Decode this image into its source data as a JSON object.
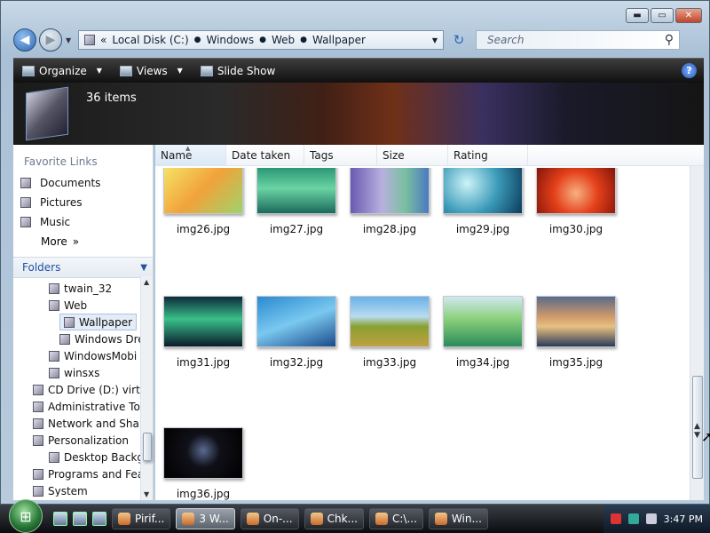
{
  "window": {
    "controls": {
      "minimize": "▬",
      "maximize": "▭",
      "close": "✕"
    }
  },
  "address": {
    "back_icon": "back-arrow-icon",
    "forward_icon": "forward-arrow-icon",
    "lead": "«",
    "crumbs": [
      "Local Disk (C:)",
      "Windows",
      "Web",
      "Wallpaper"
    ],
    "search_placeholder": "Search"
  },
  "toolbar": {
    "organize": "Organize",
    "views": "Views",
    "slideshow": "Slide Show",
    "help": "?"
  },
  "header": {
    "item_count": "36 items"
  },
  "sidebar": {
    "favorite_links_heading": "Favorite Links",
    "links": [
      "Documents",
      "Pictures",
      "Music"
    ],
    "more": "More",
    "folders_heading": "Folders",
    "tree": [
      {
        "label": "twain_32",
        "indent": 1
      },
      {
        "label": "Web",
        "indent": 1
      },
      {
        "label": "Wallpaper",
        "indent": 2,
        "selected": true
      },
      {
        "label": "Windows Dre",
        "indent": 2
      },
      {
        "label": "WindowsMobi",
        "indent": 1
      },
      {
        "label": "winsxs",
        "indent": 1
      },
      {
        "label": "CD Drive (D:) virtio",
        "indent": 0
      },
      {
        "label": "Administrative Too",
        "indent": 0
      },
      {
        "label": "Network and Shari",
        "indent": 0
      },
      {
        "label": "Personalization",
        "indent": 0
      },
      {
        "label": "Desktop Backgro",
        "indent": 1
      },
      {
        "label": "Programs and Feat",
        "indent": 0
      },
      {
        "label": "System",
        "indent": 0
      }
    ]
  },
  "columns": [
    "Name",
    "Date taken",
    "Tags",
    "Size",
    "Rating"
  ],
  "files": [
    {
      "name": "img26.jpg",
      "bg": "linear-gradient(135deg,#f5e66a,#f2a23a 50%,#9fd36a)"
    },
    {
      "name": "img27.jpg",
      "bg": "linear-gradient(180deg,#1f8a6a,#6ad4a4 50%,#1a6a5a)"
    },
    {
      "name": "img28.jpg",
      "bg": "linear-gradient(90deg,#6a5ab0,#b8b0e0 40%,#7ac0a0 70%,#4a7ac0)"
    },
    {
      "name": "img29.jpg",
      "bg": "radial-gradient(circle at 30% 40%,#cdf3f8,#3a9ab8 50%,#0d3a5a)"
    },
    {
      "name": "img30.jpg",
      "bg": "radial-gradient(circle at 50% 60%,#f7b080,#e4401a 45%,#7a1008)"
    },
    {
      "name": "img31.jpg",
      "bg": "linear-gradient(180deg,#0c2a3a,#3ac08a 45%,#0a1a2a)"
    },
    {
      "name": "img32.jpg",
      "bg": "linear-gradient(160deg,#2a8ad0,#7ac8f0 50%,#1a4a8a)"
    },
    {
      "name": "img33.jpg",
      "bg": "linear-gradient(180deg,#6ab0e8 0%,#b8dcf0 40%,#8aa030 60%,#c0a040 100%)"
    },
    {
      "name": "img34.jpg",
      "bg": "linear-gradient(180deg,#cfe8f0 0%,#8ad07a 45%,#2a8a5a 100%)"
    },
    {
      "name": "img35.jpg",
      "bg": "linear-gradient(180deg,#5a6a8a 0%,#d09a6a 40%,#e8c080 60%,#2a3a5a 100%)"
    },
    {
      "name": "img36.jpg",
      "bg": "radial-gradient(circle at 50% 45%,#5a6a90,#101018 35%,#000 100%)"
    }
  ],
  "taskbar": {
    "start_icon": "windows-orb-icon",
    "tasks": [
      {
        "label": "Pirif...",
        "active": false
      },
      {
        "label": "3 W...",
        "active": true
      },
      {
        "label": "On-...",
        "active": false
      },
      {
        "label": "Chk...",
        "active": false
      },
      {
        "label": "C:\\...",
        "active": false
      },
      {
        "label": "Win...",
        "active": false
      }
    ],
    "clock": "3:47 PM"
  }
}
